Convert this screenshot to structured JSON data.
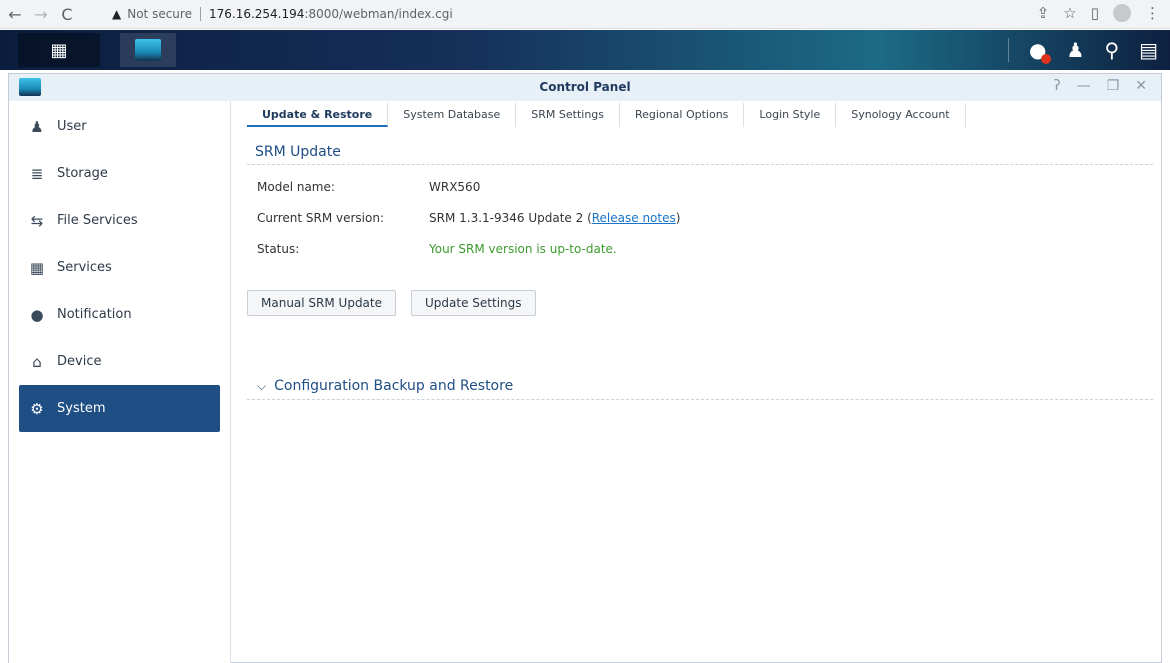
{
  "browser": {
    "not_secure": "Not secure",
    "url_host": "176.16.254.194",
    "url_path": ":8000/webman/index.cgi"
  },
  "window": {
    "title": "Control Panel"
  },
  "sidebar": {
    "items": [
      {
        "label": "User",
        "icon": "user-icon"
      },
      {
        "label": "Storage",
        "icon": "storage-icon"
      },
      {
        "label": "File Services",
        "icon": "file-services-icon"
      },
      {
        "label": "Services",
        "icon": "services-icon"
      },
      {
        "label": "Notification",
        "icon": "notification-icon"
      },
      {
        "label": "Device",
        "icon": "device-icon"
      },
      {
        "label": "System",
        "icon": "gear-icon",
        "active": true
      }
    ]
  },
  "tabs": [
    {
      "label": "Update & Restore",
      "active": true
    },
    {
      "label": "System Database"
    },
    {
      "label": "SRM Settings"
    },
    {
      "label": "Regional Options"
    },
    {
      "label": "Login Style"
    },
    {
      "label": "Synology Account"
    }
  ],
  "srm_update": {
    "title": "SRM Update",
    "model_label": "Model name:",
    "model_value": "WRX560",
    "version_label": "Current SRM version:",
    "version_value": "SRM 1.3.1-9346 Update 2 (",
    "release_notes": "Release notes",
    "version_close": ")",
    "status_label": "Status:",
    "status_value": "Your SRM version is up-to-date.",
    "manual_button": "Manual SRM Update",
    "settings_button": "Update Settings"
  },
  "config_section": {
    "title": "Configuration Backup and Restore"
  },
  "colors": {
    "accent": "#1f4e85",
    "status_ok": "#3e9b2f",
    "link": "#1a73c8"
  }
}
